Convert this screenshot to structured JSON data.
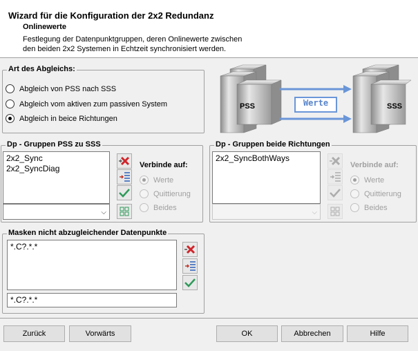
{
  "header": {
    "title": "Wizard für die Konfiguration der 2x2 Redundanz",
    "subtitle": "Onlinewerte",
    "description_line1": "Festlegung der Datenpunktgruppen, deren Onlinewerte zwischen",
    "description_line2": "den beiden 2x2 Systemen in Echtzeit synchronisiert werden."
  },
  "sync_mode": {
    "title": "Art des Abgleichs:",
    "options": [
      {
        "label": "Abgleich von PSS nach SSS",
        "selected": false
      },
      {
        "label": "Abgleich vom aktiven zum passiven System",
        "selected": false
      },
      {
        "label": "Abgleich in beice Richtungen",
        "selected": true
      }
    ]
  },
  "diagram": {
    "left_server": "PSS",
    "right_server": "SSS",
    "center_label": "Werte",
    "arrow_color": "#6a96d8"
  },
  "groups_pss": {
    "title": "Dp - Gruppen PSS zu SSS",
    "items": [
      "2x2_Sync",
      "2x2_SyncDiag"
    ],
    "combo_value": "",
    "connect_label": "Verbinde auf:",
    "options": [
      {
        "label": "Werte",
        "selected": true
      },
      {
        "label": "Quittierung",
        "selected": false
      },
      {
        "label": "Beides",
        "selected": false
      }
    ]
  },
  "groups_both": {
    "title": "Dp - Gruppen beide Richtungen",
    "items": [
      "2x2_SyncBothWays"
    ],
    "combo_value": "",
    "connect_label": "Verbinde auf:",
    "options": [
      {
        "label": "Werte",
        "selected": true
      },
      {
        "label": "Quittierung",
        "selected": false
      },
      {
        "label": "Beides",
        "selected": false
      }
    ]
  },
  "masks": {
    "title": "Masken nicht abzugleichender Datenpunkte",
    "items": [
      "*.C?.*.*"
    ],
    "input_value": "*.C?.*.*"
  },
  "footer": {
    "back_label": "Zurück",
    "forward_label": "Vorwärts",
    "ok_label": "OK",
    "cancel_label": "Abbrechen",
    "help_label": "Hilfe"
  },
  "colors": {
    "delete_icon": "#d0242a",
    "check_icon": "#2f9a5a",
    "add_icon": "#2a5fb8"
  }
}
